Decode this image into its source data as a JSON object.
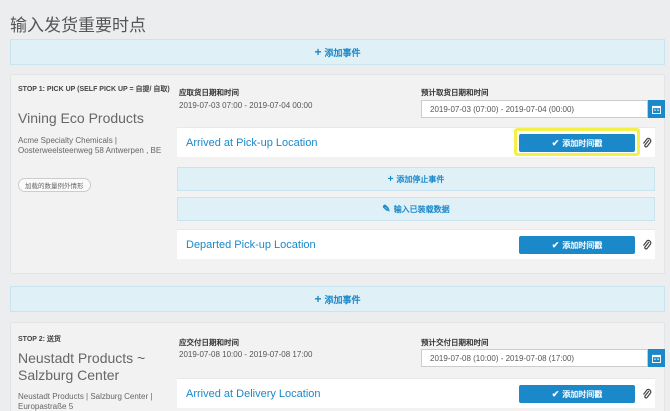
{
  "page": {
    "title": "输入发货重要时点"
  },
  "add_event_label": "添加事件",
  "columns": {
    "pickup_due": "应取货日期和时间",
    "pickup_planned": "预计取货日期和时间",
    "delivery_due": "应交付日期和时间",
    "delivery_planned": "预计交付日期和时间"
  },
  "stop1": {
    "label": "STOP 1: PICK UP (SELF PICK UP = 自提/ 自取)",
    "company": "Vining Eco Products",
    "address": "Acme Specialty Chemicals | Oosterweelsteenweg 58 Antwerpen , BE",
    "exception_button": "加载的数量例外情形",
    "due_value": "2019-07-03 07:00 - 2019-07-04 00:00",
    "planned_value": "2019-07-03 (07:00) - 2019-07-04 (00:00)",
    "events": [
      {
        "title": "Arrived at Pick-up Location",
        "button": "添加时间戳"
      },
      {
        "title": "Departed Pick-up Location",
        "button": "添加时间戳"
      }
    ],
    "add_stop_event": "添加停止事件",
    "enter_loaded_data": "输入已装载数据"
  },
  "stop2": {
    "label": "STOP 2: 送货",
    "company": "Neustadt Products ~ Salzburg Center",
    "address": "Neustadt Products | Salzburg Center | Europastraße 5",
    "due_value": "2019-07-08 10:00 - 2019-07-08 17:00",
    "planned_value": "2019-07-08 (10:00) - 2019-07-08 (17:00)",
    "events": [
      {
        "title": "Arrived at Delivery Location",
        "button": "添加时间戳"
      }
    ]
  },
  "colors": {
    "accent": "#1a88c9",
    "highlight": "#f3f04a",
    "bar_bg": "#dff0f7"
  },
  "icons": [
    "plus-icon",
    "calendar-icon",
    "check-icon",
    "paperclip-icon",
    "edit-icon"
  ]
}
